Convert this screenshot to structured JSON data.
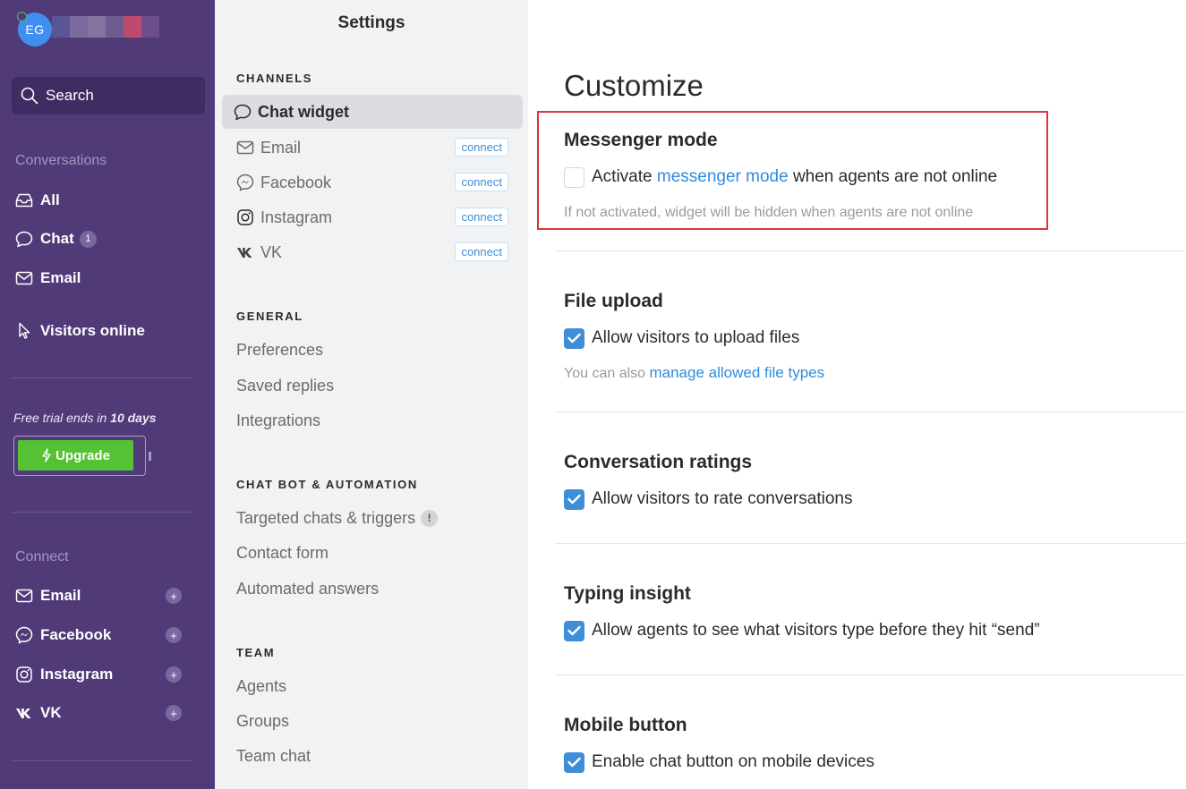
{
  "sidebar": {
    "avatar_initials": "EG",
    "search_label": "Search",
    "conversations_label": "Conversations",
    "conv_items": [
      {
        "label": "All"
      },
      {
        "label": "Chat",
        "badge": "1"
      },
      {
        "label": "Email"
      }
    ],
    "visitors_online": "Visitors online",
    "trial_text": "Free trial ends in ",
    "trial_days": "10 days",
    "upgrade_label": "Upgrade",
    "connect_label": "Connect",
    "connect_items": [
      {
        "label": "Email",
        "plus": "+"
      },
      {
        "label": "Facebook",
        "plus": "+"
      },
      {
        "label": "Instagram",
        "plus": "+"
      },
      {
        "label": "VK",
        "plus": "+"
      }
    ],
    "colors": {
      "background": "#503b78",
      "search_bg": "#3e2c63",
      "upgrade": "#54c234"
    }
  },
  "settings_nav": {
    "title": "Settings",
    "channels_header": "CHANNELS",
    "channels": [
      {
        "label": "Chat widget",
        "active": true
      },
      {
        "label": "Email",
        "action": "connect"
      },
      {
        "label": "Facebook",
        "action": "connect"
      },
      {
        "label": "Instagram",
        "action": "connect"
      },
      {
        "label": "VK",
        "action": "connect"
      }
    ],
    "general_header": "GENERAL",
    "general": [
      "Preferences",
      "Saved replies",
      "Integrations"
    ],
    "chatbot_header": "CHAT BOT & AUTOMATION",
    "chatbot": [
      {
        "label": "Targeted chats & triggers",
        "badge": "!"
      },
      {
        "label": "Contact form"
      },
      {
        "label": "Automated answers"
      }
    ],
    "team_header": "TEAM",
    "team": [
      "Agents",
      "Groups",
      "Team chat"
    ]
  },
  "main": {
    "title": "Customize",
    "sections": {
      "messenger": {
        "heading": "Messenger mode",
        "option_prefix": "Activate ",
        "option_link": "messenger mode",
        "option_suffix": " when agents are not online",
        "checked": false,
        "hint": "If not activated, widget will be hidden when agents are not online"
      },
      "file_upload": {
        "heading": "File upload",
        "option": "Allow visitors to upload files",
        "checked": true,
        "hint_prefix": "You can also ",
        "hint_link": "manage allowed file types"
      },
      "ratings": {
        "heading": "Conversation ratings",
        "option": "Allow visitors to rate conversations",
        "checked": true
      },
      "typing": {
        "heading": "Typing insight",
        "option": "Allow agents to see what visitors type before they hit “send”",
        "checked": true
      },
      "mobile": {
        "heading": "Mobile button",
        "option": "Enable chat button on mobile devices",
        "checked": true
      }
    },
    "colors": {
      "accent": "#3f8ed8",
      "link": "#2f8be0",
      "highlight": "#d9363e"
    }
  }
}
